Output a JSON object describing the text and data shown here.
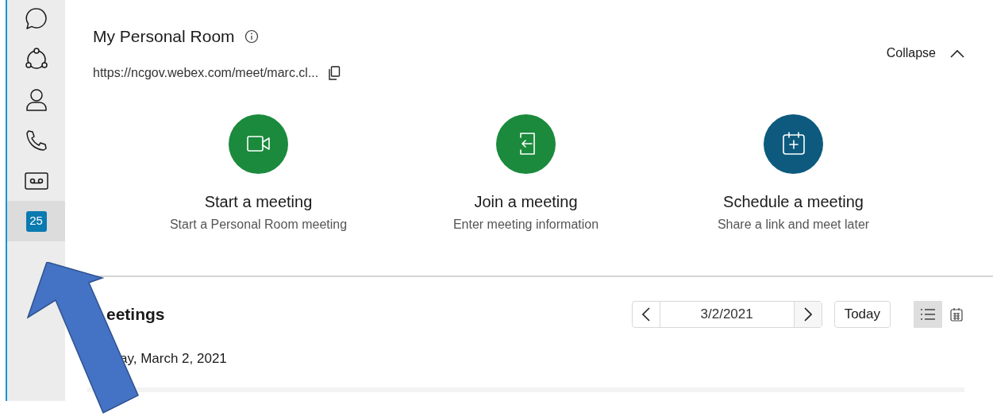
{
  "sidebar": {
    "items": [
      {
        "kind": "chat",
        "selected": false
      },
      {
        "kind": "teams",
        "selected": false
      },
      {
        "kind": "contacts",
        "selected": false
      },
      {
        "kind": "calls",
        "selected": false
      },
      {
        "kind": "voicemail",
        "selected": false
      },
      {
        "kind": "calendar",
        "selected": true,
        "badge": "25"
      }
    ]
  },
  "personal_room": {
    "title": "My Personal Room",
    "url": "https://ncgov.webex.com/meet/marc.cl...",
    "collapse": "Collapse",
    "actions": [
      {
        "kind": "video",
        "color": "#1b8a3c",
        "title": "Start a meeting",
        "subtitle": "Start a Personal Room meeting"
      },
      {
        "kind": "join",
        "color": "#1b8a3c",
        "title": "Join a meeting",
        "subtitle": "Enter meeting information"
      },
      {
        "kind": "schedule",
        "color": "#0d5a7e",
        "title": "Schedule a meeting",
        "subtitle": "Share a link and meet later"
      }
    ]
  },
  "meetings": {
    "title": "eetings",
    "date": "3/2/2021",
    "today": "Today",
    "views": [
      {
        "kind": "list",
        "selected": true
      },
      {
        "kind": "calendar",
        "selected": false
      }
    ],
    "day_heading": "ay, March 2, 2021"
  }
}
